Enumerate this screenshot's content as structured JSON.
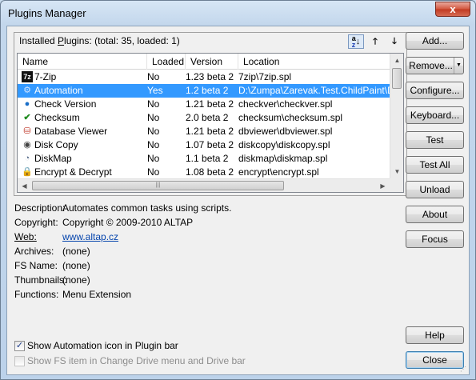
{
  "window": {
    "title": "Plugins Manager",
    "close_glyph": "x"
  },
  "installed": {
    "label_prefix": "Installed ",
    "label_underlined": "P",
    "label_rest": "lugins: (total: 35, loaded: 1)"
  },
  "columns": [
    "Name",
    "Loaded",
    "Version",
    "Location"
  ],
  "plugins": [
    {
      "name": "7-Zip",
      "loaded": "No",
      "version": "1.23 beta 2",
      "location": "7zip\\7zip.spl",
      "icon": "7z-icon"
    },
    {
      "name": "Automation",
      "loaded": "Yes",
      "version": "1.2 beta 2",
      "location": "D:\\Zumpa\\Zarevak.Test.ChildPaint\\De",
      "icon": "gear-icon",
      "selected": true
    },
    {
      "name": "Check Version",
      "loaded": "No",
      "version": "1.21 beta 2",
      "location": "checkver\\checkver.spl",
      "icon": "globe-icon"
    },
    {
      "name": "Checksum",
      "loaded": "No",
      "version": "2.0 beta 2",
      "location": "checksum\\checksum.spl",
      "icon": "checkmark-icon"
    },
    {
      "name": "Database Viewer",
      "loaded": "No",
      "version": "1.21 beta 2",
      "location": "dbviewer\\dbviewer.spl",
      "icon": "database-icon"
    },
    {
      "name": "Disk Copy",
      "loaded": "No",
      "version": "1.07 beta 2",
      "location": "diskcopy\\diskcopy.spl",
      "icon": "disk-icon"
    },
    {
      "name": "DiskMap",
      "loaded": "No",
      "version": "1.1 beta 2",
      "location": "diskmap\\diskmap.spl",
      "icon": "diskmap-icon"
    },
    {
      "name": "Encrypt & Decrypt",
      "loaded": "No",
      "version": "1.08 beta 2",
      "location": "encrypt\\encrypt.spl",
      "icon": "lock-icon"
    }
  ],
  "details": {
    "description_label": "Description:",
    "description": "Automates common tasks using scripts.",
    "copyright_label": "Copyright:",
    "copyright": "Copyright © 2009-2010 ALTAP",
    "web_label": "Web:",
    "web": "www.altap.cz",
    "archives_label": "Archives:",
    "archives": "(none)",
    "fsname_label": "FS Name:",
    "fsname": "(none)",
    "thumbnails_label": "Thumbnails:",
    "thumbnails": "(none)",
    "functions_label": "Functions:",
    "functions": "Menu Extension"
  },
  "buttons": {
    "add": "Add...",
    "remove": "Remove...",
    "configure": "Configure...",
    "keyboard": "Keyboard...",
    "test": "Test",
    "test_all": "Test All",
    "unload": "Unload",
    "about": "About",
    "focus": "Focus",
    "help": "Help",
    "close": "Close"
  },
  "checkboxes": {
    "show_plugin_bar": {
      "label": "Show Automation icon in Plugin bar",
      "checked": true,
      "enabled": true
    },
    "show_fs_item": {
      "label": "Show FS item in Change Drive menu and Drive bar",
      "checked": false,
      "enabled": false
    }
  }
}
